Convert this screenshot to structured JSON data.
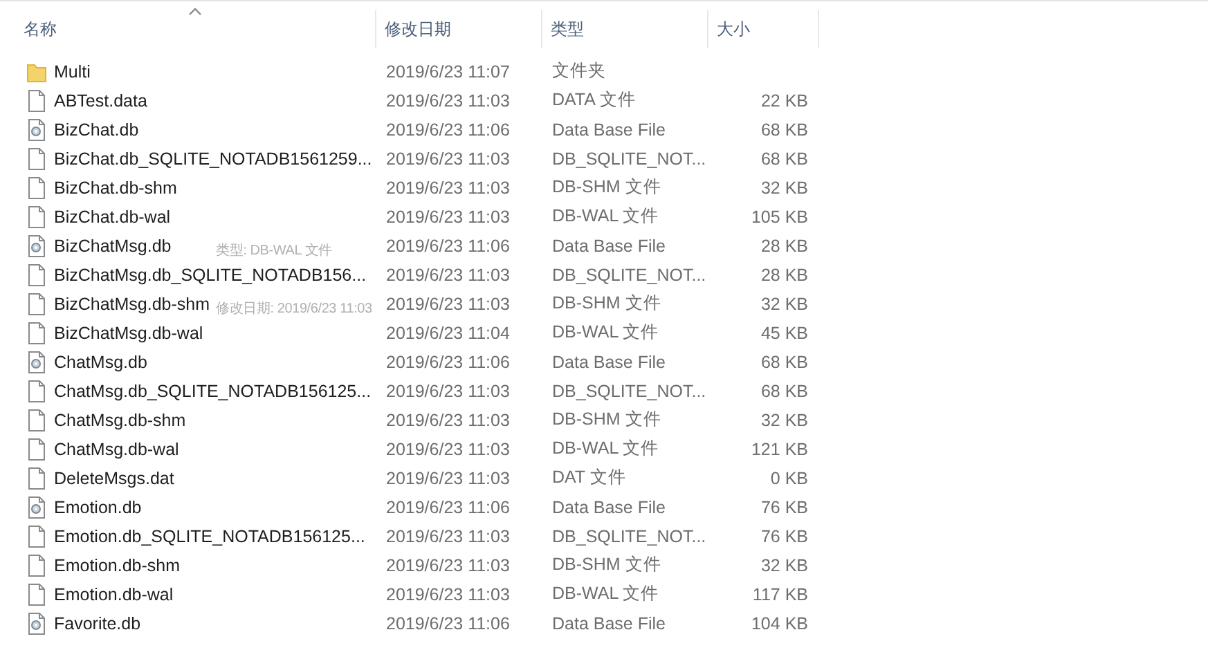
{
  "columns": [
    {
      "label": "名称",
      "sorted": true
    },
    {
      "label": "修改日期",
      "sorted": false
    },
    {
      "label": "类型",
      "sorted": false
    },
    {
      "label": "大小",
      "sorted": false
    }
  ],
  "rows": [
    {
      "kind": "folder",
      "name": "Multi",
      "date": "2019/6/23 11:07",
      "type": "文件夹"
    },
    {
      "kind": "file",
      "name": "ABTest.data",
      "date": "2019/6/23 11:03",
      "type": "DATA 文件",
      "size": "22 KB"
    },
    {
      "kind": "db",
      "name": "BizChat.db",
      "date": "2019/6/23 11:06",
      "type": "Data Base File",
      "size": "68 KB"
    },
    {
      "kind": "file",
      "name": "BizChat.db_SQLITE_NOTADB1561259...",
      "date": "2019/6/23 11:03",
      "type": "DB_SQLITE_NOT...",
      "size": "68 KB"
    },
    {
      "kind": "file",
      "name": "BizChat.db-shm",
      "date": "2019/6/23 11:03",
      "type": "DB-SHM 文件",
      "size": "32 KB"
    },
    {
      "kind": "file",
      "name": "BizChat.db-wal",
      "date": "2019/6/23 11:03",
      "type": "DB-WAL 文件",
      "size": "105 KB"
    },
    {
      "kind": "db",
      "name": "BizChatMsg.db",
      "date": "2019/6/23 11:06",
      "type": "Data Base File",
      "size": "28 KB"
    },
    {
      "kind": "file",
      "name": "BizChatMsg.db_SQLITE_NOTADB156...",
      "date": "2019/6/23 11:03",
      "type": "DB_SQLITE_NOT...",
      "size": "28 KB"
    },
    {
      "kind": "file",
      "name": "BizChatMsg.db-shm",
      "date": "2019/6/23 11:03",
      "type": "DB-SHM 文件",
      "size": "32 KB"
    },
    {
      "kind": "file",
      "name": "BizChatMsg.db-wal",
      "date": "2019/6/23 11:04",
      "type": "DB-WAL 文件",
      "size": "45 KB"
    },
    {
      "kind": "db",
      "name": "ChatMsg.db",
      "date": "2019/6/23 11:06",
      "type": "Data Base File",
      "size": "68 KB"
    },
    {
      "kind": "file",
      "name": "ChatMsg.db_SQLITE_NOTADB156125...",
      "date": "2019/6/23 11:03",
      "type": "DB_SQLITE_NOT...",
      "size": "68 KB"
    },
    {
      "kind": "file",
      "name": "ChatMsg.db-shm",
      "date": "2019/6/23 11:03",
      "type": "DB-SHM 文件",
      "size": "32 KB"
    },
    {
      "kind": "file",
      "name": "ChatMsg.db-wal",
      "date": "2019/6/23 11:03",
      "type": "DB-WAL 文件",
      "size": "121 KB"
    },
    {
      "kind": "file",
      "name": "DeleteMsgs.dat",
      "date": "2019/6/23 11:03",
      "type": "DAT 文件",
      "size": "0 KB"
    },
    {
      "kind": "db",
      "name": "Emotion.db",
      "date": "2019/6/23 11:06",
      "type": "Data Base File",
      "size": "76 KB"
    },
    {
      "kind": "file",
      "name": "Emotion.db_SQLITE_NOTADB156125...",
      "date": "2019/6/23 11:03",
      "type": "DB_SQLITE_NOT...",
      "size": "76 KB"
    },
    {
      "kind": "file",
      "name": "Emotion.db-shm",
      "date": "2019/6/23 11:03",
      "type": "DB-SHM 文件",
      "size": "32 KB"
    },
    {
      "kind": "file",
      "name": "Emotion.db-wal",
      "date": "2019/6/23 11:03",
      "type": "DB-WAL 文件",
      "size": "117 KB"
    },
    {
      "kind": "db",
      "name": "Favorite.db",
      "date": "2019/6/23 11:06",
      "type": "Data Base File",
      "size": "104 KB"
    }
  ],
  "tooltip": {
    "lines": [
      "类型: DB-WAL 文件",
      "修改日期: 2019/6/23 11:03"
    ]
  }
}
